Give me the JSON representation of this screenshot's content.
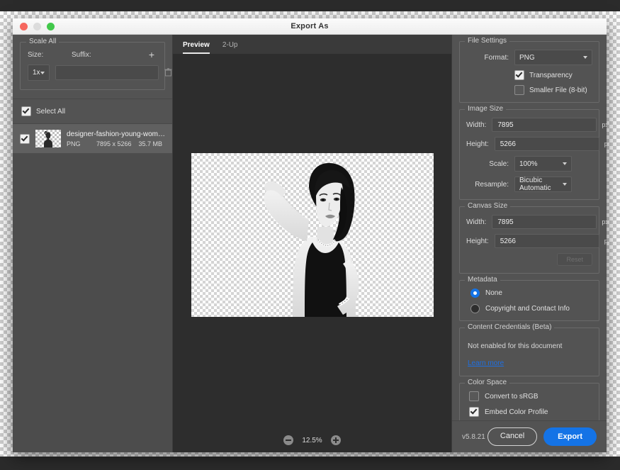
{
  "window": {
    "title": "Export As",
    "traffic_lights": [
      "close",
      "minimize",
      "zoom"
    ]
  },
  "scale_all": {
    "legend": "Scale All",
    "size_label": "Size:",
    "suffix_label": "Suffix:",
    "add_icon": "plus-icon",
    "delete_icon": "trash-icon",
    "size_value": "1x",
    "suffix_value": "",
    "suffix_placeholder": ""
  },
  "file_list": {
    "select_all_label": "Select All",
    "select_all_checked": true,
    "items": [
      {
        "name": "designer-fashion-young-woman-a...",
        "format": "PNG",
        "dimensions": "7895 x 5266",
        "size": "35.7 MB",
        "checked": true
      }
    ]
  },
  "preview": {
    "tabs": [
      {
        "label": "Preview",
        "active": true
      },
      {
        "label": "2-Up",
        "active": false
      }
    ],
    "zoom_value": "12.5%",
    "zoom_out_icon": "minus-circle-icon",
    "zoom_in_icon": "plus-circle-icon"
  },
  "file_settings": {
    "legend": "File Settings",
    "format_label": "Format:",
    "format_value": "PNG",
    "transparency_label": "Transparency",
    "transparency_checked": true,
    "smaller_file_label": "Smaller File (8-bit)",
    "smaller_file_checked": false
  },
  "image_size": {
    "legend": "Image Size",
    "width_label": "Width:",
    "width_value": "7895",
    "width_unit": "px",
    "height_label": "Height:",
    "height_value": "5266",
    "height_unit": "px",
    "scale_label": "Scale:",
    "scale_value": "100%",
    "resample_label": "Resample:",
    "resample_value": "Bicubic Automatic"
  },
  "canvas_size": {
    "legend": "Canvas Size",
    "width_label": "Width:",
    "width_value": "7895",
    "width_unit": "px",
    "height_label": "Height:",
    "height_value": "5266",
    "height_unit": "px",
    "reset_label": "Reset"
  },
  "metadata": {
    "legend": "Metadata",
    "options": [
      {
        "label": "None",
        "selected": true
      },
      {
        "label": "Copyright and Contact Info",
        "selected": false
      }
    ]
  },
  "content_credentials": {
    "legend": "Content Credentials (Beta)",
    "status": "Not enabled for this document",
    "link_label": "Learn more"
  },
  "color_space": {
    "legend": "Color Space",
    "convert_label": "Convert to sRGB",
    "convert_checked": false,
    "embed_label": "Embed Color Profile",
    "embed_checked": true
  },
  "footer": {
    "version": "v5.8.21",
    "cancel_label": "Cancel",
    "export_label": "Export",
    "accent_color": "#1473e6"
  }
}
